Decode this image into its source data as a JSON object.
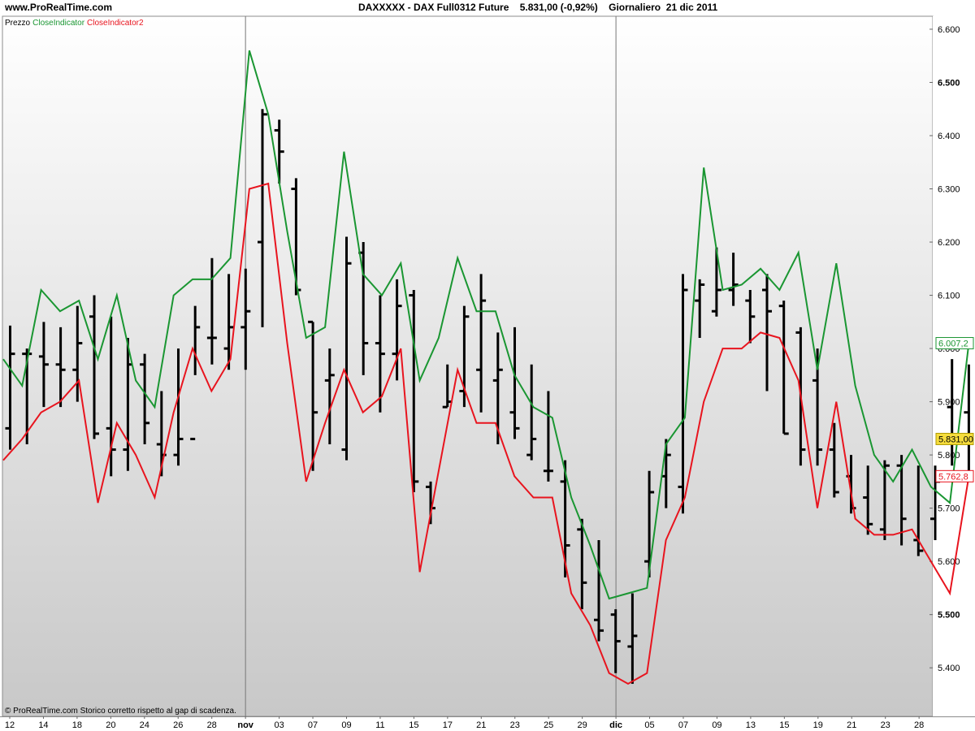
{
  "header": {
    "site": "www.ProRealTime.com",
    "title": "DAXXXXX - DAX Full0312 Future    5.831,00 (-0,92%)    Giornaliero  21 dic 2011"
  },
  "legend": {
    "price": "Prezzo",
    "ind1": "CloseIndicator",
    "ind2": "CloseIndicator2"
  },
  "footer": {
    "note": "© ProRealTime.com  Storico corretto rispetto al gap di scadenza."
  },
  "colors": {
    "price": "#000000",
    "ind1": "#1a9632",
    "ind2": "#e8141e",
    "last_price_bg": "#f5dc3c"
  },
  "chart_data": {
    "type": "ohlc-with-lines",
    "yaxis": {
      "ylim": [
        5330,
        6630
      ],
      "ticks": [
        5400,
        5500,
        5600,
        5700,
        5800,
        5900,
        6000,
        6100,
        6200,
        6300,
        6400,
        6500,
        6600
      ],
      "tick_labels": [
        "5.400",
        "5.500",
        "5.600",
        "5.700",
        "5.800",
        "5.900",
        "6.000",
        "6.100",
        "6.200",
        "6.300",
        "6.400",
        "6.500",
        "6.600"
      ],
      "bold_labels": [
        "5.500",
        "6.500"
      ]
    },
    "xaxis": {
      "labels": [
        "12",
        "14",
        "18",
        "20",
        "24",
        "26",
        "28",
        "nov",
        "03",
        "07",
        "09",
        "11",
        "15",
        "17",
        "21",
        "23",
        "25",
        "29",
        "dic",
        "05",
        "07",
        "09",
        "13",
        "15",
        "19",
        "21",
        "23",
        "28"
      ],
      "bold_labels": [
        "nov",
        "dic"
      ],
      "separator_labels": [
        "nov",
        "dic"
      ]
    },
    "ohlc": [
      {
        "h": 6043,
        "l": 5810,
        "o": 5850,
        "c": 5990
      },
      {
        "h": 6000,
        "l": 5820,
        "o": 5990,
        "c": 5990
      },
      {
        "h": 6050,
        "l": 5890,
        "o": 5985,
        "c": 5970
      },
      {
        "h": 6040,
        "l": 5890,
        "o": 5970,
        "c": 5960
      },
      {
        "h": 6080,
        "l": 5900,
        "o": 5960,
        "c": 6010
      },
      {
        "h": 6100,
        "l": 5830,
        "o": 6060,
        "c": 5840
      },
      {
        "h": 6060,
        "l": 5760,
        "o": 5850,
        "c": 5810
      },
      {
        "h": 6020,
        "l": 5770,
        "o": 5810,
        "c": 5970
      },
      {
        "h": 5990,
        "l": 5820,
        "o": 5970,
        "c": 5860
      },
      {
        "h": 5920,
        "l": 5760,
        "o": 5820,
        "c": 5800
      },
      {
        "h": 6000,
        "l": 5780,
        "o": 5800,
        "c": 5830
      },
      {
        "h": 6080,
        "l": 5950,
        "o": 5830,
        "c": 6040
      },
      {
        "h": 6170,
        "l": 5970,
        "o": 6020,
        "c": 6020
      },
      {
        "h": 6140,
        "l": 5960,
        "o": 6000,
        "c": 6040
      },
      {
        "h": 6150,
        "l": 5960,
        "o": 6040,
        "c": 6070
      },
      {
        "h": 6450,
        "l": 6040,
        "o": 6200,
        "c": 6440
      },
      {
        "h": 6430,
        "l": 6310,
        "o": 6410,
        "c": 6370
      },
      {
        "h": 6320,
        "l": 6100,
        "o": 6300,
        "c": 6110
      },
      {
        "h": 6050,
        "l": 5770,
        "o": 6050,
        "c": 5880
      },
      {
        "h": 6000,
        "l": 5820,
        "o": 5940,
        "c": 5950
      },
      {
        "h": 6210,
        "l": 5790,
        "o": 5810,
        "c": 6160
      },
      {
        "h": 6200,
        "l": 5950,
        "o": 6180,
        "c": 6010
      },
      {
        "h": 6100,
        "l": 5880,
        "o": 6010,
        "c": 5990
      },
      {
        "h": 6130,
        "l": 5940,
        "o": 5990,
        "c": 6080
      },
      {
        "h": 6110,
        "l": 5730,
        "o": 6100,
        "c": 5750
      },
      {
        "h": 5750,
        "l": 5670,
        "o": 5740,
        "c": 5700
      },
      {
        "h": 5970,
        "l": 5890,
        "o": 5890,
        "c": 5900
      },
      {
        "h": 6080,
        "l": 5890,
        "o": 5920,
        "c": 6060
      },
      {
        "h": 6140,
        "l": 5880,
        "o": 5960,
        "c": 6090
      },
      {
        "h": 6030,
        "l": 5820,
        "o": 5940,
        "c": 5960
      },
      {
        "h": 6040,
        "l": 5830,
        "o": 5880,
        "c": 5850
      },
      {
        "h": 5970,
        "l": 5790,
        "o": 5800,
        "c": 5830
      },
      {
        "h": 5920,
        "l": 5750,
        "o": 5770,
        "c": 5770
      },
      {
        "h": 5790,
        "l": 5570,
        "o": 5750,
        "c": 5630
      },
      {
        "h": 5680,
        "l": 5510,
        "o": 5660,
        "c": 5560
      },
      {
        "h": 5640,
        "l": 5450,
        "o": 5490,
        "c": 5470
      },
      {
        "h": 5510,
        "l": 5390,
        "o": 5500,
        "c": 5450
      },
      {
        "h": 5540,
        "l": 5370,
        "o": 5440,
        "c": 5460
      },
      {
        "h": 5770,
        "l": 5570,
        "o": 5600,
        "c": 5730
      },
      {
        "h": 5830,
        "l": 5700,
        "o": 5760,
        "c": 5800
      },
      {
        "h": 6140,
        "l": 5690,
        "o": 5740,
        "c": 6110
      },
      {
        "h": 6130,
        "l": 6020,
        "o": 6090,
        "c": 6120
      },
      {
        "h": 6190,
        "l": 6060,
        "o": 6070,
        "c": 6110
      },
      {
        "h": 6180,
        "l": 6080,
        "o": 6110,
        "c": 6120
      },
      {
        "h": 6110,
        "l": 6010,
        "o": 6090,
        "c": 6060
      },
      {
        "h": 6140,
        "l": 5920,
        "o": 6110,
        "c": 6070
      },
      {
        "h": 6090,
        "l": 5840,
        "o": 6080,
        "c": 5840
      },
      {
        "h": 6040,
        "l": 5780,
        "o": 6030,
        "c": 5810
      },
      {
        "h": 6000,
        "l": 5780,
        "o": 5940,
        "c": 5810
      },
      {
        "h": 5860,
        "l": 5720,
        "o": 5810,
        "c": 5730
      },
      {
        "h": 5800,
        "l": 5690,
        "o": 5760,
        "c": 5700
      },
      {
        "h": 5780,
        "l": 5650,
        "o": 5720,
        "c": 5670
      },
      {
        "h": 5790,
        "l": 5640,
        "o": 5660,
        "c": 5780
      },
      {
        "h": 5800,
        "l": 5630,
        "o": 5780,
        "c": 5680
      },
      {
        "h": 5780,
        "l": 5610,
        "o": 5640,
        "c": 5620
      },
      {
        "h": 5780,
        "l": 5640,
        "o": 5680,
        "c": 5750
      },
      {
        "h": 5980,
        "l": 5780,
        "o": 5890,
        "c": 5830
      },
      {
        "h": 5970,
        "l": 5770,
        "o": 5880,
        "c": 5830
      }
    ],
    "series": [
      {
        "name": "CloseIndicator",
        "values": [
          5980,
          5930,
          6110,
          6070,
          6090,
          5980,
          6100,
          5940,
          5890,
          6100,
          6130,
          6130,
          6170,
          6560,
          6440,
          6220,
          6020,
          6040,
          6370,
          6140,
          6100,
          6160,
          5940,
          6020,
          6170,
          6070,
          6070,
          5950,
          5890,
          5870,
          5720,
          5630,
          5530,
          5540,
          5550,
          5820,
          5870,
          6340,
          6110,
          6120,
          6150,
          6110,
          6180,
          5960,
          6160,
          5930,
          5800,
          5750,
          5810,
          5740,
          5710,
          6010
        ]
      },
      {
        "name": "CloseIndicator2",
        "values": [
          5790,
          5830,
          5880,
          5900,
          5940,
          5710,
          5860,
          5800,
          5720,
          5880,
          6000,
          5920,
          5980,
          6300,
          6310,
          6010,
          5750,
          5860,
          5960,
          5880,
          5910,
          6000,
          5580,
          5770,
          5960,
          5860,
          5860,
          5760,
          5720,
          5720,
          5540,
          5480,
          5390,
          5370,
          5390,
          5640,
          5720,
          5900,
          6000,
          6000,
          6030,
          6020,
          5940,
          5700,
          5900,
          5680,
          5650,
          5650,
          5660,
          5600,
          5540,
          5760
        ]
      }
    ],
    "last_values": {
      "price": "5.831,00",
      "CloseIndicator": "6.007,2",
      "CloseIndicator2": "5.762,8"
    }
  }
}
